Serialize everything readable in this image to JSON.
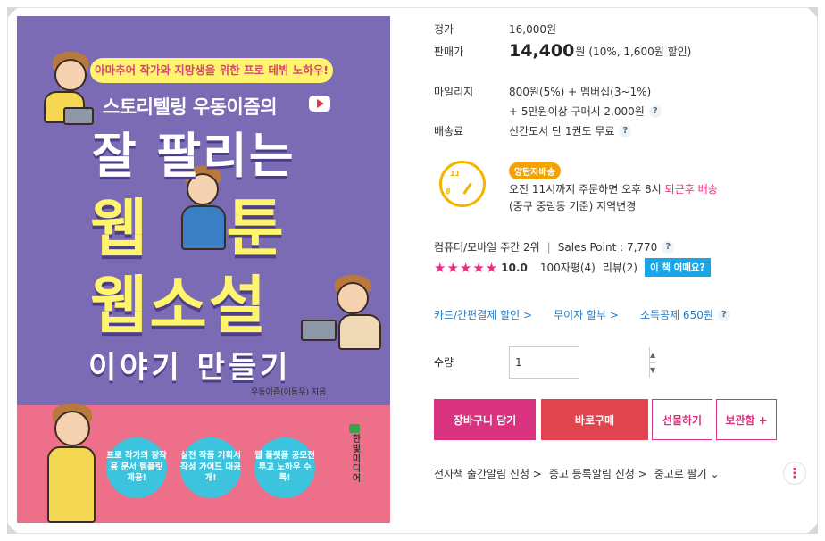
{
  "cover": {
    "banner": "아마추어 작가와 지망생을 위한 프로 데뷔 노하우!",
    "subtitle": "스토리텔링 우동이즘의",
    "title_line1": "잘 팔리는",
    "title_line2": "웹툰",
    "title_line3": "웹소설",
    "title_line4": "이야기 만들기",
    "author": "우동이즘(이동우) 지음",
    "bubbles": [
      "프로 작가의 창작용 문서 템플릿 제공!",
      "실전 작품 기획서 작성 가이드 대공개!",
      "웹 플랫폼 공모전 투고 노하우 수록!"
    ],
    "publisher": "한빛미디어"
  },
  "price": {
    "list_label": "정가",
    "list_value": "16,000원",
    "sale_label": "판매가",
    "sale_value": "14,400",
    "sale_unit": "원",
    "sale_note": "(10%, 1,600원 할인)"
  },
  "mileage": {
    "label": "마일리지",
    "line1": "800원(5%) + 멤버십(3~1%)",
    "line2": "+ 5만원이상 구매시 2,000원"
  },
  "shipping": {
    "label": "배송료",
    "value": "신간도서 단 1권도 무료"
  },
  "delivery": {
    "clock_11": "11",
    "clock_8": "8",
    "badge": "양탄자배송",
    "line1_prefix": "오전 11시까지 주문하면 오후 8시",
    "line1_highlight": "퇴근후 배송",
    "line2": "(중구 중림동 기준) 지역변경"
  },
  "ranking": {
    "rank_text": "컴퓨터/모바일 주간 2위",
    "separator": "|",
    "sales_point": "Sales Point : 7,770"
  },
  "rating": {
    "stars": "★★★★★",
    "score": "10.0",
    "reviews_100": "100자평(4)",
    "reviews": "리뷰(2)",
    "this_book": "이 책 어때요?"
  },
  "links": {
    "card": "카드/간편결제 할인 >",
    "installment": "무이자 할부 >",
    "deduction": "소득공제 650원"
  },
  "quantity": {
    "label": "수량",
    "value": "1"
  },
  "buttons": {
    "cart": "장바구니 담기",
    "buy": "바로구매",
    "gift": "선물하기",
    "save": "보관함 +"
  },
  "footer_links": {
    "ebook": "전자책 출간알림 신청 >",
    "used_notify": "중고 등록알림 신청 >",
    "used_sell": "중고로 팔기 ⌄"
  },
  "colors": {
    "accent_pink": "#d9327f",
    "buy_red": "#e0444f",
    "cover_purple": "#7b6bb4",
    "cover_pink": "#ee6f8a",
    "cover_yellow": "#fff46e"
  }
}
